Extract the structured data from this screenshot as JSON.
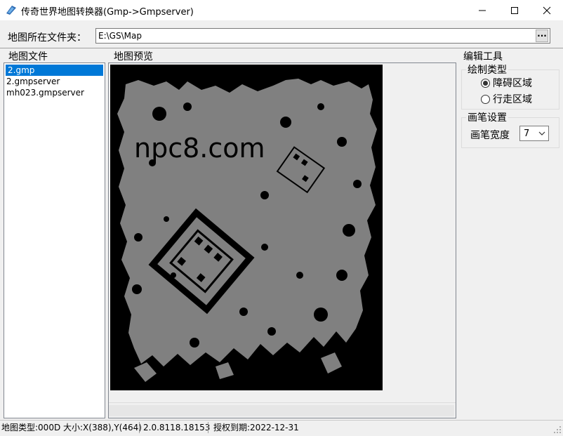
{
  "window": {
    "title": "传奇世界地图转换器(Gmp->Gmpserver)"
  },
  "folder": {
    "label": "地图所在文件夹：",
    "value": "E:\\GS\\Map",
    "browse_label": "···"
  },
  "sections": {
    "files": "地图文件",
    "preview": "地图预览",
    "tools": "编辑工具"
  },
  "file_list": [
    {
      "name": "2.gmp",
      "selected": true
    },
    {
      "name": "2.gmpserver",
      "selected": false
    },
    {
      "name": "mh023.gmpserver",
      "selected": false
    }
  ],
  "map_preview": {
    "watermark": "npc8.com",
    "colors": {
      "background": "#000000",
      "walkable": "#808080"
    }
  },
  "draw_type": {
    "title": "绘制类型",
    "options": [
      {
        "label": "障碍区域",
        "checked": true
      },
      {
        "label": "行走区域",
        "checked": false
      }
    ]
  },
  "brush": {
    "title": "画笔设置",
    "width_label": "画笔宽度",
    "width_value": "7"
  },
  "status": {
    "map_info": "地图类型:000D 大小:X(388),Y(464)",
    "version": "2.0.8118.18153",
    "license": "授权到期:2022-12-31"
  },
  "colors": {
    "selection": "#0078d7",
    "window_bg": "#f0f0f0"
  }
}
